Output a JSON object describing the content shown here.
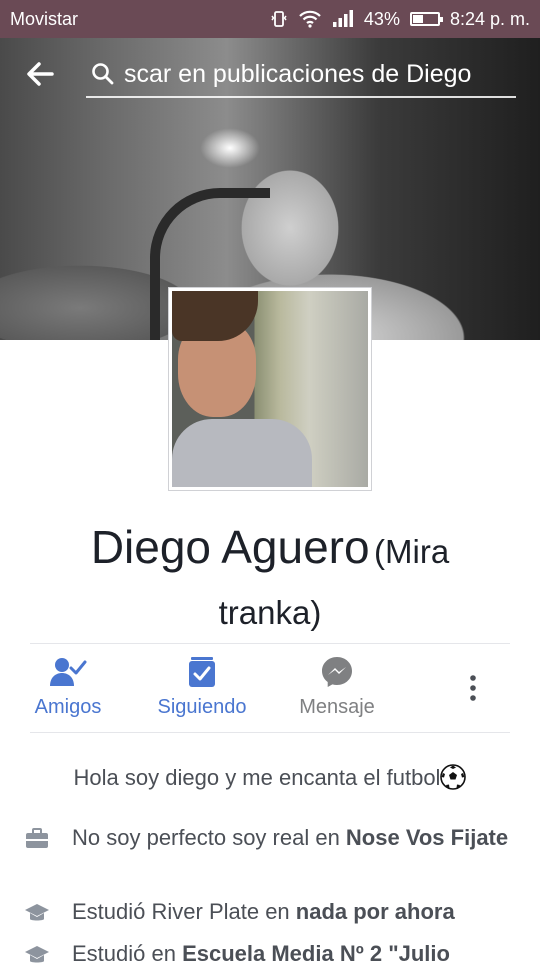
{
  "status_bar": {
    "carrier": "Movistar",
    "battery_percent": "43%",
    "battery_level": 0.43,
    "time": "8:24 p. m."
  },
  "header": {
    "search_text": "scar en publicaciones de Diego"
  },
  "profile": {
    "name": "Diego Aguero",
    "alt_name_line1": "(Mira",
    "alt_name_line2": "tranka)"
  },
  "actions": {
    "friends": "Amigos",
    "following": "Siguiendo",
    "message": "Mensaje"
  },
  "bio": "Hola soy diego y me encanta el futbol",
  "details": [
    {
      "prefix": "No soy perfecto  soy real en ",
      "bold": "Nose Vos Fijate",
      "icon": "briefcase-icon"
    },
    {
      "prefix": "Estudió River Plate en ",
      "bold": "nada por ahora",
      "icon": "graduation-cap-icon"
    },
    {
      "prefix": "Estudió en ",
      "bold": "Escuela Media Nº 2 \"Julio",
      "icon": "graduation-cap-icon"
    }
  ],
  "colors": {
    "accent_blue": "#4a76d0",
    "text_gray": "#4b4f56",
    "status_bar": "#6a4a55"
  }
}
